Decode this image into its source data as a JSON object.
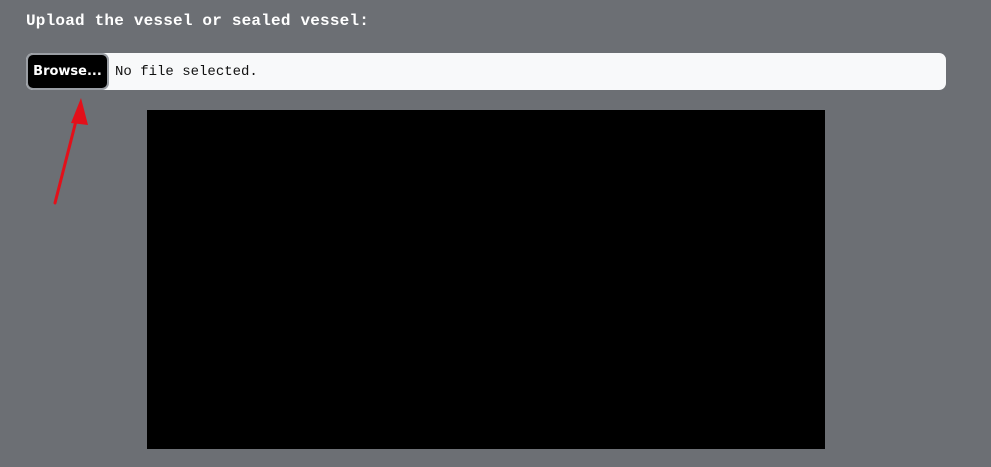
{
  "upload": {
    "heading": "Upload the vessel or sealed vessel:",
    "browse_label": "Browse...",
    "status": "No file selected."
  },
  "annotation": {
    "arrow_color": "#e3101a"
  },
  "colors": {
    "background": "#6c6f74",
    "input_background": "#f8f9fa",
    "preview_background": "#000000"
  }
}
